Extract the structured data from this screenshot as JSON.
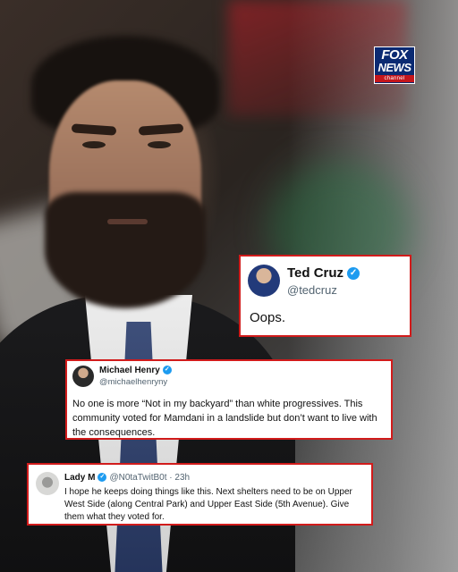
{
  "logo": {
    "line1": "FOX",
    "line2": "NEWS",
    "line3": "channel",
    "colors": {
      "background": "#0b2a72",
      "band": "#c4161c"
    }
  },
  "tweets": [
    {
      "name": "Ted Cruz",
      "handle": "@tedcruz",
      "verified_icon": "verified-check-icon",
      "text": "Oops."
    },
    {
      "name": "Michael Henry",
      "handle": "@michaelhenryny",
      "verified_icon": "verified-check-icon",
      "text": "No one is more “Not in my backyard” than white progressives. This community voted for Mamdani in a landslide but don’t want to live with the consequences."
    },
    {
      "name": "Lady M",
      "handle": "@N0taTwitB0t",
      "time": "· 23h",
      "verified_icon": "verified-check-icon",
      "text": "I hope he keeps doing things like this. Next shelters need to be on Upper West Side (along Central Park) and Upper East Side (5th Avenue). Give them what they voted for."
    }
  ],
  "colors": {
    "card_border": "#d11b1b",
    "verified": "#1d9bf0",
    "handle": "#536471"
  }
}
